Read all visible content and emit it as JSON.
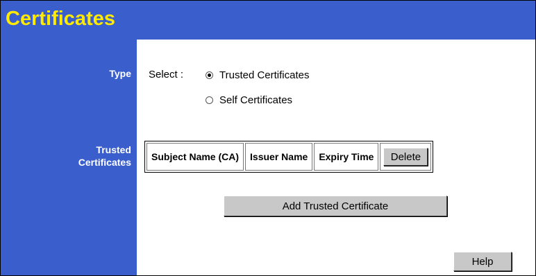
{
  "page": {
    "title": "Certificates",
    "accent_color": "#3a5fcd",
    "title_color": "#ffea00"
  },
  "labels": {
    "type": "Type",
    "trusted_line1": "Trusted",
    "trusted_line2": "Certificates"
  },
  "type_select": {
    "prefix": "Select :",
    "options": [
      {
        "label": "Trusted Certificates",
        "selected": true
      },
      {
        "label": "Self Certificates",
        "selected": false
      }
    ]
  },
  "table": {
    "columns": [
      "Subject Name (CA)",
      "Issuer Name",
      "Expiry Time"
    ],
    "delete_label": "Delete"
  },
  "buttons": {
    "add_trusted": "Add Trusted Certificate",
    "help": "Help"
  }
}
